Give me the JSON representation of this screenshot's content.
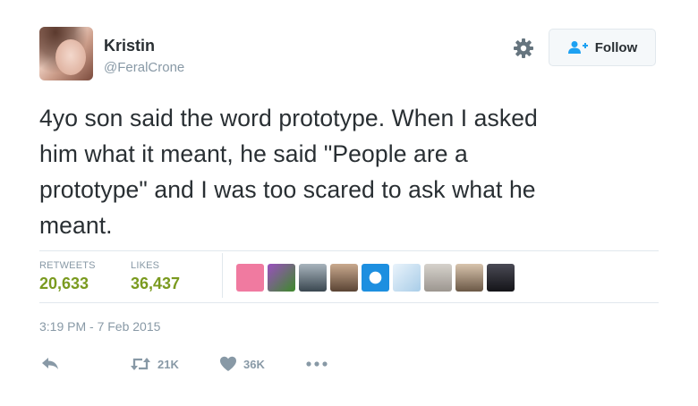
{
  "user": {
    "name": "Kristin",
    "handle": "@FeralCrone"
  },
  "follow_label": "Follow",
  "tweet_lines": [
    "4yo son said the word prototype. When I asked",
    "him what it meant, he said \"People are a",
    "prototype\" and I was too scared to ask what he",
    "meant."
  ],
  "stats": {
    "retweets_label": "RETWEETS",
    "retweets_count": "20,633",
    "likes_label": "LIKES",
    "likes_count": "36,437"
  },
  "likers": [
    {
      "name": "liker-avatar-1",
      "color": "#f07aa0"
    },
    {
      "name": "liker-avatar-2",
      "color": "#7b3fa0"
    },
    {
      "name": "liker-avatar-3",
      "color": "#4a5a66"
    },
    {
      "name": "liker-avatar-4",
      "color": "#8a6a52"
    },
    {
      "name": "liker-avatar-5",
      "color": "#1d8fe0"
    },
    {
      "name": "liker-avatar-6",
      "color": "#cfe3f2"
    },
    {
      "name": "liker-avatar-7",
      "color": "#b9b4ad"
    },
    {
      "name": "liker-avatar-8",
      "color": "#a8927c"
    },
    {
      "name": "liker-avatar-9",
      "color": "#2a2a30"
    }
  ],
  "timestamp": "3:19 PM - 7 Feb 2015",
  "actions": {
    "retweet_count": "21K",
    "like_count": "36K"
  },
  "icons": [
    "gear-icon",
    "follow-person-plus-icon",
    "reply-icon",
    "retweet-icon",
    "heart-icon",
    "more-icon"
  ],
  "colors": {
    "accent_green": "#7a9a1f",
    "muted": "#8899a6",
    "link_blue": "#1da1f2"
  }
}
